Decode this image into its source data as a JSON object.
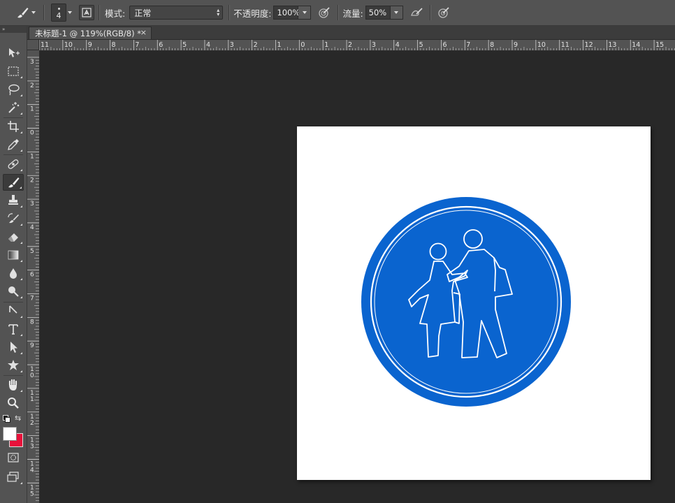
{
  "options_bar": {
    "brush_size": "4",
    "mode_label": "模式:",
    "mode_value": "正常",
    "opacity_label": "不透明度:",
    "opacity_value": "100%",
    "flow_label": "流量:",
    "flow_value": "50%"
  },
  "tab": {
    "title": "未标题-1 @ 119%(RGB/8) *",
    "close": "×"
  },
  "toolbar": {
    "collapse": "»",
    "tools": [
      "move-tool",
      "marquee-tool",
      "lasso-tool",
      "magic-wand-tool",
      "crop-tool",
      "eyedropper-tool",
      "healing-brush-tool",
      "brush-tool",
      "clone-stamp-tool",
      "history-brush-tool",
      "eraser-tool",
      "gradient-tool",
      "blur-tool",
      "dodge-tool",
      "pen-tool",
      "type-tool",
      "path-selection-tool",
      "shape-tool",
      "hand-tool",
      "zoom-tool"
    ],
    "active_tool": "brush-tool",
    "foreground_color": "#ffffff",
    "background_color": "#e8103a"
  },
  "rulers": {
    "horizontal": [
      "11",
      "10",
      "9",
      "8",
      "7",
      "6",
      "5",
      "4",
      "3",
      "2",
      "1",
      "0",
      "1",
      "2",
      "3",
      "4",
      "5",
      "6",
      "7",
      "8",
      "9",
      "10",
      "11",
      "12",
      "13",
      "14",
      "15"
    ],
    "vertical": [
      "3",
      "2",
      "1",
      "0",
      "1",
      "2",
      "3",
      "4",
      "5",
      "6",
      "7",
      "8",
      "9",
      "1\n0",
      "1\n1",
      "1\n2",
      "1\n3",
      "1\n4",
      "1\n5"
    ]
  },
  "canvas": {
    "background": "#ffffff",
    "sign_color": "#0a64cf",
    "sign_outline": "#ffffff"
  }
}
